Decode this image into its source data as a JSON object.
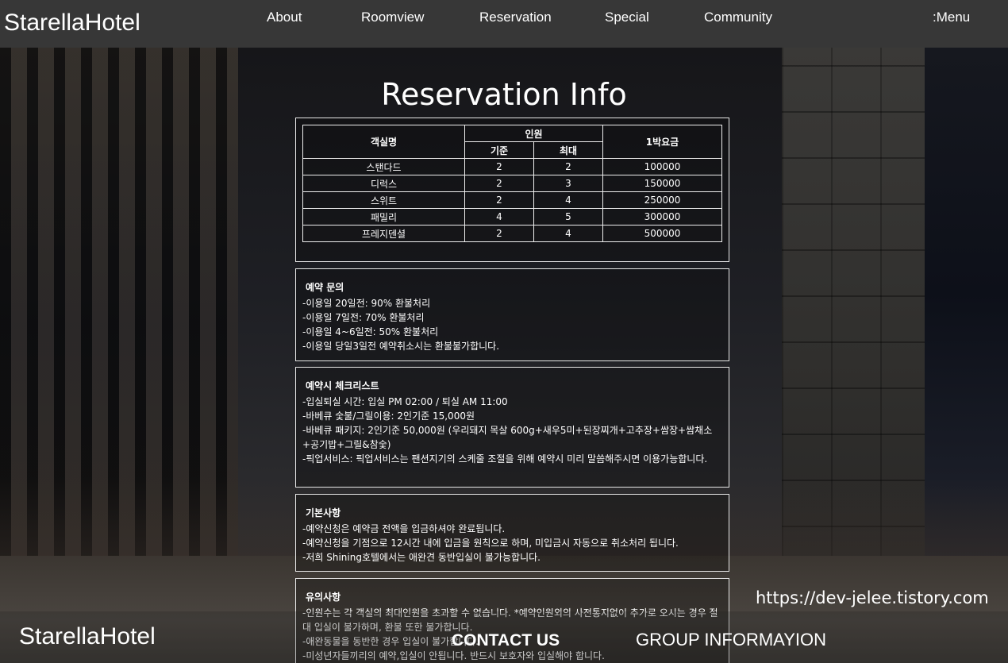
{
  "header": {
    "brand": "StarellaHotel",
    "nav": [
      "About",
      "Roomview",
      "Reservation",
      "Special",
      "Community"
    ],
    "menu": ":Menu"
  },
  "page_title": "Reservation Info",
  "rate_table": {
    "headers": {
      "room": "객실명",
      "capacity": "인원",
      "base": "기준",
      "max": "최대",
      "price": "1박요금"
    },
    "rows": [
      [
        "스탠다드",
        "2",
        "2",
        "100000"
      ],
      [
        "디럭스",
        "2",
        "3",
        "150000"
      ],
      [
        "스위트",
        "2",
        "4",
        "250000"
      ],
      [
        "패밀리",
        "4",
        "5",
        "300000"
      ],
      [
        "프레지덴셜",
        "2",
        "4",
        "500000"
      ]
    ]
  },
  "sections": [
    {
      "title": "예약 문의",
      "lines": [
        "-이용일 20일전: 90% 환불처리",
        "-이용일 7일전: 70% 환불처리",
        "-이용일 4~6일전: 50% 환불처리",
        "-이용일 당일3일전 예약취소시는 환불불가합니다."
      ]
    },
    {
      "title": "예약시 체크리스트",
      "lines": [
        "-입실퇴실 시간: 입실 PM 02:00 / 퇴실 AM 11:00",
        "-바베큐 숯불/그릴이용: 2인기준 15,000원",
        "-바베큐 패키지: 2인기준 50,000원 (우리돼지 목살 600g+새우5미+된장찌개+고추장+쌈장+쌈채소+공기밥+그릴&참숯)",
        "-픽업서비스: 픽업서비스는 팬션지기의 스케줄 조절을 위해 예약시 미리 말씀해주시면 이용가능합니다."
      ]
    },
    {
      "title": "기본사항",
      "lines": [
        "-예약신청은 예약금 전액을 입금하셔야 완료됩니다.",
        "-예약신청을 기점으로 12시간 내에 입금을 원칙으로 하며, 미입금시 자동으로 취소처리 됩니다.",
        "-저희 Shining호텔에서는 애완견 동반입실이 불가능합니다."
      ]
    },
    {
      "title": "유의사항",
      "lines": [
        "-인원수는 각 객실의 최대인원을 초과할 수 없습니다. *예약인원외의 사전통지없이 추가로 오시는 경우 절대 입실이 불가하며, 환불 또한 불가합니다.",
        "-애완동물을 동반한 경우 입실이 불가합니다.",
        "-미성년자들끼리의 예약,입실이 안됩니다. 반드시 보호자와 입실해야 합니다."
      ]
    }
  ],
  "footer": {
    "brand": "StarellaHotel",
    "contact": "CONTACT US",
    "group": "GROUP  INFORMAYION"
  },
  "watermark": "https://dev-jelee.tistory.com"
}
